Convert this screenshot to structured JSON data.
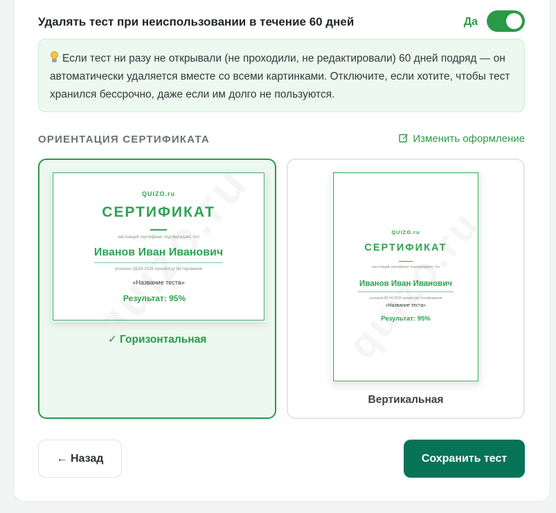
{
  "auto_delete": {
    "label": "Удалять тест при неиспользовании в течение 60 дней",
    "state_label": "Да",
    "enabled": true,
    "info_icon": "lightbulb-icon",
    "info_text": "Если тест ни разу не открывали (не проходили, не редактировали) 60 дней подряд — он автоматически удаляется вместе со всеми картинками. Отключите, если хотите, чтобы тест хранился бессрочно, даже если им долго не пользуются."
  },
  "orientation": {
    "heading": "ОРИЕНТАЦИЯ СЕРТИФИКАТА",
    "edit_link_label": "Изменить оформление",
    "edit_icon": "edit-icon",
    "selected": "horizontal",
    "options": {
      "horizontal": {
        "label": "✓ Горизонтальная"
      },
      "vertical": {
        "label": "Вертикальная"
      }
    },
    "certificate_preview": {
      "brand": "QUIZO.ru",
      "title": "СЕРТИФИКАТ",
      "subtitle": "настоящий сертификат подтверждает, что",
      "name": "Иванов Иван Иванович",
      "passed_text": "успешно 03.04.2026 прошёл(а) тестирование",
      "test_name": "«Название теста»",
      "result": "Результат: 95%",
      "watermark": "quizo.ru"
    },
    "accent_color": "#2fa352"
  },
  "actions": {
    "back_label": "← Назад",
    "save_label": "Сохранить тест"
  },
  "colors": {
    "primary_button": "#077457",
    "toggle_on": "#2a9a46",
    "selected_bg": "#ecf8f0"
  }
}
